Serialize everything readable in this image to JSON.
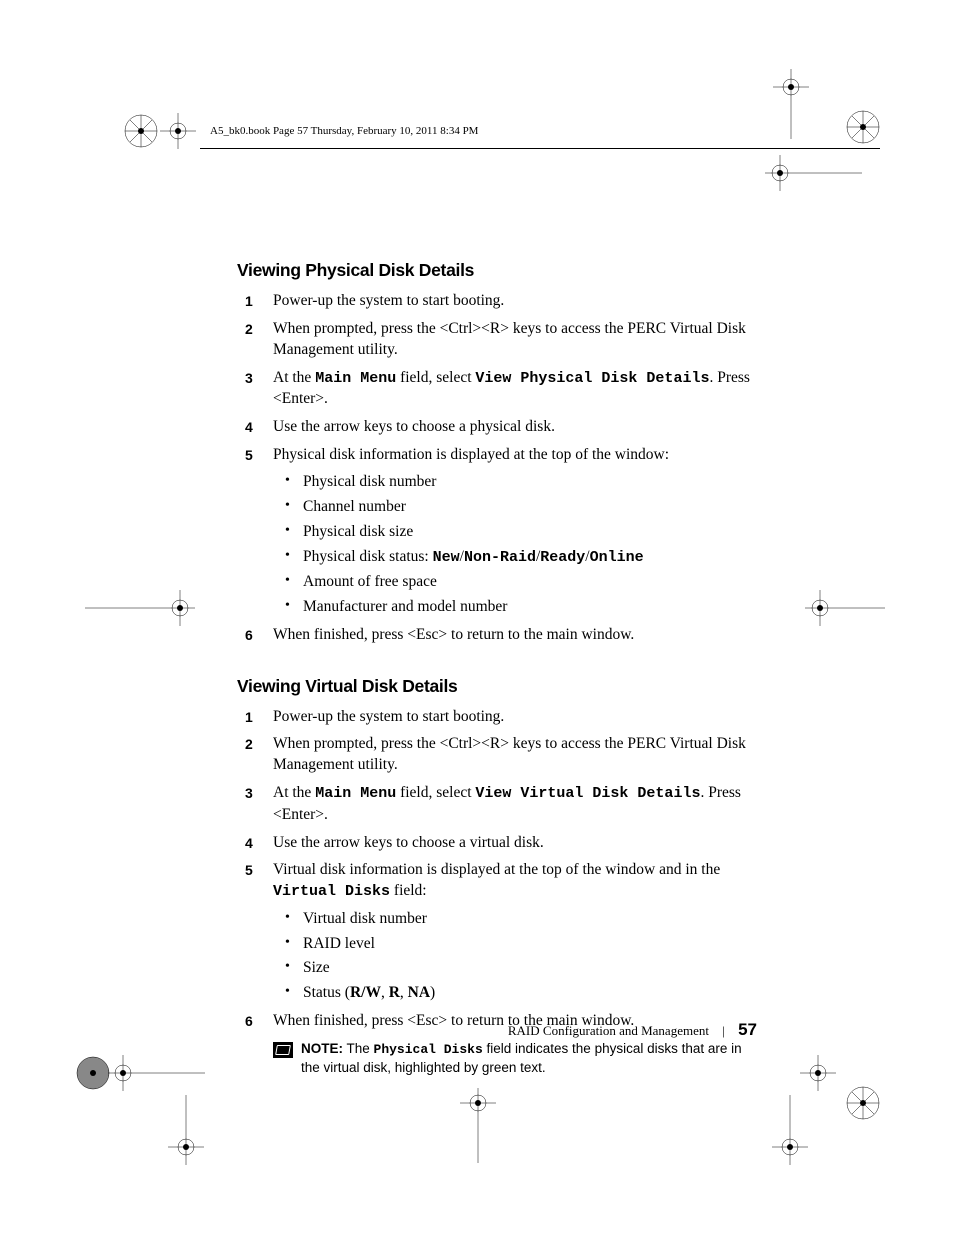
{
  "header_line": "A5_bk0.book  Page 57  Thursday, February 10, 2011  8:34 PM",
  "section1": {
    "title": "Viewing Physical Disk Details",
    "steps": {
      "s1": "Power-up the system to start booting.",
      "s2": "When prompted, press the <Ctrl><R> keys to access the PERC Virtual Disk Management utility.",
      "s3_a": "At the ",
      "s3_mono1": "Main Menu",
      "s3_b": " field, select ",
      "s3_mono2": "View Physical Disk Details",
      "s3_c": ". Press <Enter>.",
      "s4": "Use the arrow keys to choose a physical disk.",
      "s5": "Physical disk information is displayed at the top of the window:",
      "s5_items": {
        "a": "Physical disk number",
        "b": "Channel number",
        "c": "Physical disk size",
        "d_a": "Physical disk status: ",
        "d_new": "New",
        "d_nonraid": "Non-Raid",
        "d_ready": "Ready",
        "d_online": "Online",
        "e": "Amount of free space",
        "f": "Manufacturer and model number"
      },
      "s6": "When finished, press <Esc> to return to the main window."
    }
  },
  "section2": {
    "title": "Viewing Virtual Disk Details",
    "steps": {
      "s1": "Power-up the system to start booting.",
      "s2": "When prompted, press the <Ctrl><R> keys to access the PERC Virtual Disk Management utility.",
      "s3_a": "At the ",
      "s3_mono1": "Main Menu",
      "s3_b": " field, select ",
      "s3_mono2": "View Virtual Disk Details",
      "s3_c": ". Press <Enter>.",
      "s4": "Use the arrow keys to choose a virtual disk.",
      "s5_a": "Virtual disk information is displayed at the top of the window and in the ",
      "s5_mono": "Virtual Disks",
      "s5_b": " field:",
      "s5_items": {
        "a": "Virtual disk number",
        "b": "RAID level",
        "c": "Size",
        "d_a": "Status (",
        "d_rw": "R/W",
        "d_sep1": ", ",
        "d_r": "R",
        "d_sep2": ", ",
        "d_na": "NA",
        "d_end": ")"
      },
      "s6": "When finished, press <Esc> to return to the main window."
    },
    "note": {
      "label": "NOTE:",
      "a": " The ",
      "mono": "Physical Disks",
      "b": " field indicates the physical disks that are in the virtual disk, highlighted by green text."
    }
  },
  "footer": {
    "text": "RAID Configuration and Management",
    "page": "57"
  }
}
